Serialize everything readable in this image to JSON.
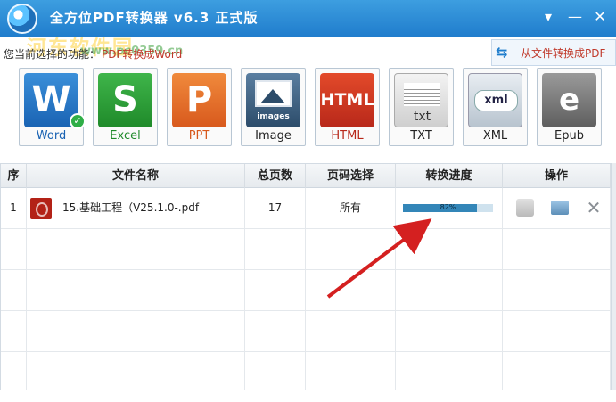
{
  "window": {
    "title": "全方位PDF转换器 v6.3 正式版",
    "controls": {
      "menu": "▾",
      "minimize": "—",
      "close": "✕"
    }
  },
  "watermark": {
    "text": "河东软件园",
    "url": "www.pc0359.cn"
  },
  "function_bar": {
    "label": "您当前选择的功能：",
    "value": "PDF转换成Word",
    "switch_button": "从文件转换成PDF"
  },
  "formats": [
    {
      "label": "Word",
      "glyph": "W",
      "selected": true
    },
    {
      "label": "Excel",
      "glyph": "S"
    },
    {
      "label": "PPT",
      "glyph": "P"
    },
    {
      "label": "Image",
      "glyph": "images"
    },
    {
      "label": "HTML",
      "glyph": "HTML"
    },
    {
      "label": "TXT",
      "glyph": "txt"
    },
    {
      "label": "XML",
      "glyph": "xml"
    },
    {
      "label": "Epub",
      "glyph": "e"
    }
  ],
  "table": {
    "columns": [
      "序",
      "文件名称",
      "总页数",
      "页码选择",
      "转换进度",
      "操作"
    ],
    "rows": [
      {
        "index": "1",
        "filename": "15.基础工程（V25.1.0-.pdf",
        "pages": "17",
        "page_select": "所有",
        "progress_text": "82%",
        "progress": 0.82
      }
    ]
  },
  "colors": {
    "title_bar": "#2b8ad6",
    "accent_red": "#c0392b",
    "progress": "#3386b8",
    "arrow": "#d42020"
  }
}
